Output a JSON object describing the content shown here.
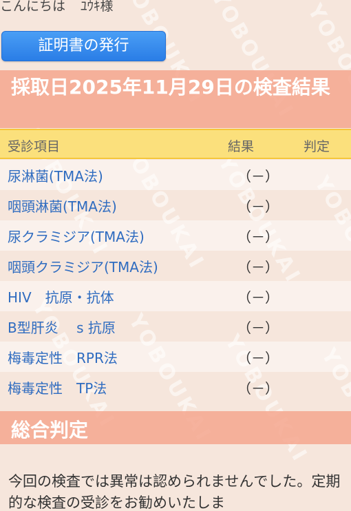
{
  "greeting": {
    "hello": "こんにちは",
    "name": "ﾕｳｷ様"
  },
  "certificate_button": "証明書の発行",
  "date_header": "採取日2025年11月29日の検査結果",
  "watermark": "YOBOUKAI",
  "table": {
    "headers": [
      "受診項目",
      "結果",
      "判定"
    ],
    "rows": [
      {
        "item": "尿淋菌(TMA法)",
        "result": "（－）",
        "judgement": ""
      },
      {
        "item": "咽頭淋菌(TMA法)",
        "result": "（－）",
        "judgement": ""
      },
      {
        "item": "尿クラミジア(TMA法)",
        "result": "（－）",
        "judgement": ""
      },
      {
        "item": "咽頭クラミジア(TMA法)",
        "result": "（－）",
        "judgement": ""
      },
      {
        "item": "HIV　抗原・抗体",
        "result": "（－）",
        "judgement": ""
      },
      {
        "item": "B型肝炎　 s 抗原",
        "result": "（－）",
        "judgement": ""
      },
      {
        "item": "梅毒定性　RPR法",
        "result": "（－）",
        "judgement": ""
      },
      {
        "item": "梅毒定性　TP法",
        "result": "（－）",
        "judgement": ""
      }
    ]
  },
  "overall": {
    "title": "総合判定",
    "text": "今回の検査では異常は認められませんでした。定期的な検査の受診をお勧めいたしま"
  },
  "colors": {
    "background": "#f6e6dc",
    "section_header": "#f4a68e",
    "table_header": "#fbe07c",
    "button": "#2a7de6",
    "link_text": "#2f6cc0"
  }
}
